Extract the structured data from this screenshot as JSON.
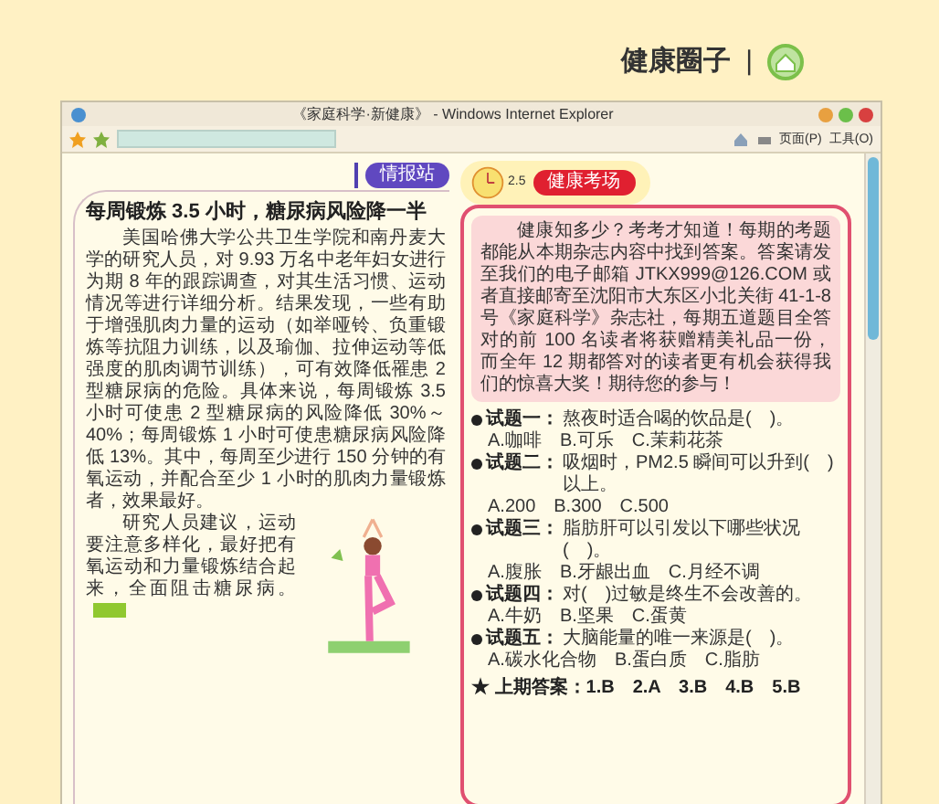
{
  "header": {
    "title": "健康圈子",
    "separator": "|"
  },
  "browser": {
    "title": "《家庭科学·新健康》 - Windows Internet Explorer",
    "page_menu": "页面(P)",
    "tools_menu": "工具(O)"
  },
  "article": {
    "section_label": "情报站",
    "title": "每周锻炼 3.5 小时，糖尿病风险降一半",
    "paragraphs": [
      "美国哈佛大学公共卫生学院和南丹麦大学的研究人员，对 9.93 万名中老年妇女进行为期 8 年的跟踪调查，对其生活习惯、运动情况等进行详细分析。结果发现，一些有助于增强肌肉力量的运动（如举哑铃、负重锻炼等抗阻力训练，以及瑜伽、拉伸运动等低强度的肌肉调节训练），可有效降低罹患 2 型糖尿病的危险。具体来说，每周锻炼 3.5 小时可使患 2 型糖尿病的风险降低 30%～40%；每周锻炼 1 小时可使患糖尿病风险降低 13%。其中，每周至少进行 150 分钟的有氧运动，并配合至少 1 小时的肌肉力量锻炼者，效果最好。",
      "研究人员建议，运动要注意多样化，最好把有氧运动和力量锻炼结合起来，全面阻击糖尿病。"
    ]
  },
  "quiz": {
    "clock_label": "2.5",
    "badge": "健康考场",
    "intro": "健康知多少？考考才知道！每期的考题都能从本期杂志内容中找到答案。答案请发至我们的电子邮箱 JTKX999@126.COM 或者直接邮寄至沈阳市大东区小北关街 41-1-8 号《家庭科学》杂志社，每期五道题目全答对的前 100 名读者将获赠精美礼品一份，而全年 12 期都答对的读者更有机会获得我们的惊喜大奖！期待您的参与！",
    "questions": [
      {
        "label": "试题一：",
        "text": "熬夜时适合喝的饮品是(　)。",
        "options": "A.咖啡　B.可乐　C.茉莉花茶"
      },
      {
        "label": "试题二：",
        "text": "吸烟时，PM2.5 瞬间可以升到(　)以上。",
        "options": "A.200　B.300　C.500"
      },
      {
        "label": "试题三：",
        "text": "脂肪肝可以引发以下哪些状况(　)。",
        "options": "A.腹胀　B.牙龈出血　C.月经不调"
      },
      {
        "label": "试题四：",
        "text": "对(　)过敏是终生不会改善的。",
        "options": "A.牛奶　B.坚果　C.蛋黄"
      },
      {
        "label": "试题五：",
        "text": "大脑能量的唯一来源是(　)。",
        "options": "A.碳水化合物　B.蛋白质　C.脂肪"
      }
    ],
    "last_answers": "★ 上期答案：1.B　2.A　3.B　4.B　5.B"
  }
}
